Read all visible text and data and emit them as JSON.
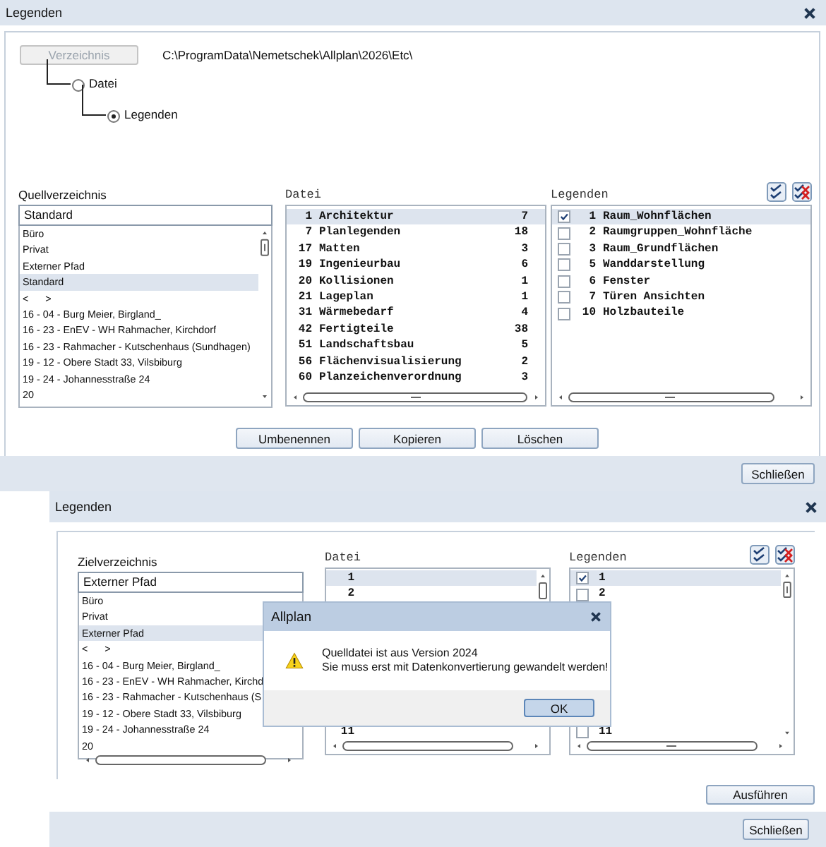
{
  "main_dialog": {
    "title": "Legenden",
    "directory_button": {
      "label": "Verzeichnis",
      "disabled": true
    },
    "path": "C:\\ProgramData\\Nemetschek\\Allplan\\2026\\Etc\\",
    "radios": [
      {
        "label": "Datei",
        "selected": false
      },
      {
        "label": "Legenden",
        "selected": true
      }
    ],
    "source": {
      "label": "Quellverzeichnis",
      "combo_value": "Standard",
      "items": [
        {
          "text": "Büro",
          "selected": false
        },
        {
          "text": "Privat",
          "selected": false
        },
        {
          "text": "Externer Pfad",
          "selected": false
        },
        {
          "text": "Standard",
          "selected": true
        },
        {
          "text": "<      >",
          "selected": false
        },
        {
          "text": "16 - 04 - Burg Meier, Birgland_",
          "selected": false
        },
        {
          "text": "16 - 23 - EnEV - WH Rahmacher, Kirchdorf",
          "selected": false
        },
        {
          "text": "16 - 23 - Rahmacher - Kutschenhaus (Sundhagen)",
          "selected": false
        },
        {
          "text": "19 - 12 - Obere Stadt 33, Vilsbiburg",
          "selected": false
        },
        {
          "text": "19 - 24 - Johannesstraße 24",
          "selected": false
        },
        {
          "text": "20",
          "selected": false
        }
      ]
    },
    "files": {
      "label": "Datei",
      "rows": [
        {
          "number": "1",
          "name": "Architektur",
          "count": "7",
          "selected": true
        },
        {
          "number": "7",
          "name": "Planlegenden",
          "count": "18",
          "selected": false
        },
        {
          "number": "17",
          "name": "Matten",
          "count": "3",
          "selected": false
        },
        {
          "number": "19",
          "name": "Ingenieurbau",
          "count": "6",
          "selected": false
        },
        {
          "number": "20",
          "name": "Kollisionen",
          "count": "1",
          "selected": false
        },
        {
          "number": "21",
          "name": "Lageplan",
          "count": "1",
          "selected": false
        },
        {
          "number": "31",
          "name": "Wärmebedarf",
          "count": "4",
          "selected": false
        },
        {
          "number": "42",
          "name": "Fertigteile",
          "count": "38",
          "selected": false
        },
        {
          "number": "51",
          "name": "Landschaftsbau",
          "count": "5",
          "selected": false
        },
        {
          "number": "56",
          "name": "Flächenvisualisierung",
          "count": "2",
          "selected": false
        },
        {
          "number": "60",
          "name": "Planzeichenverordnung",
          "count": "3",
          "selected": false
        }
      ]
    },
    "legends": {
      "label": "Legenden",
      "rows": [
        {
          "number": "1",
          "name": "Raum_Wohnflächen",
          "checked": true,
          "selected": true
        },
        {
          "number": "2",
          "name": "Raumgruppen_Wohnfläche",
          "checked": false,
          "selected": false
        },
        {
          "number": "3",
          "name": "Raum_Grundflächen",
          "checked": false,
          "selected": false
        },
        {
          "number": "5",
          "name": "Wanddarstellung",
          "checked": false,
          "selected": false
        },
        {
          "number": "6",
          "name": "Fenster",
          "checked": false,
          "selected": false
        },
        {
          "number": "7",
          "name": "Türen Ansichten",
          "checked": false,
          "selected": false
        },
        {
          "number": "10",
          "name": "Holzbauteile",
          "checked": false,
          "selected": false
        }
      ]
    },
    "actions": [
      "Umbenennen",
      "Kopieren",
      "Löschen"
    ],
    "close_button": "Schließen"
  },
  "second_dialog": {
    "title": "Legenden",
    "target": {
      "label": "Zielverzeichnis",
      "combo_value": "Externer Pfad",
      "items": [
        {
          "text": "Büro",
          "selected": false
        },
        {
          "text": "Privat",
          "selected": false
        },
        {
          "text": "Externer Pfad",
          "selected": true
        },
        {
          "text": "<      >",
          "selected": false
        },
        {
          "text": "16 - 04 - Burg Meier, Birgland_",
          "selected": false
        },
        {
          "text": "16 - 23 - EnEV - WH Rahmacher, Kirchd",
          "selected": false
        },
        {
          "text": "16 - 23 - Rahmacher - Kutschenhaus (S",
          "selected": false
        },
        {
          "text": "19 - 12 - Obere Stadt 33, Vilsbiburg",
          "selected": false
        },
        {
          "text": "19 - 24 - Johannesstraße 24",
          "selected": false
        },
        {
          "text": "20",
          "selected": false
        }
      ]
    },
    "files": {
      "label": "Datei",
      "rows": [
        {
          "number": "1",
          "selected": true
        },
        {
          "number": "2",
          "selected": false
        },
        {
          "number": "11",
          "selected": false
        }
      ]
    },
    "legends": {
      "label": "Legenden",
      "rows": [
        {
          "number": "1",
          "checked": true,
          "selected": true
        },
        {
          "number": "2",
          "checked": false,
          "selected": false
        },
        {
          "number": "11",
          "checked": false,
          "selected": false
        }
      ]
    },
    "execute_button": "Ausführen",
    "close_button": "Schließen"
  },
  "message_box": {
    "title": "Allplan",
    "lines": [
      "Quelldatei ist aus Version 2024",
      "Sie muss erst mit Datenkonvertierung gewandelt werden!"
    ],
    "ok_button": "OK"
  }
}
